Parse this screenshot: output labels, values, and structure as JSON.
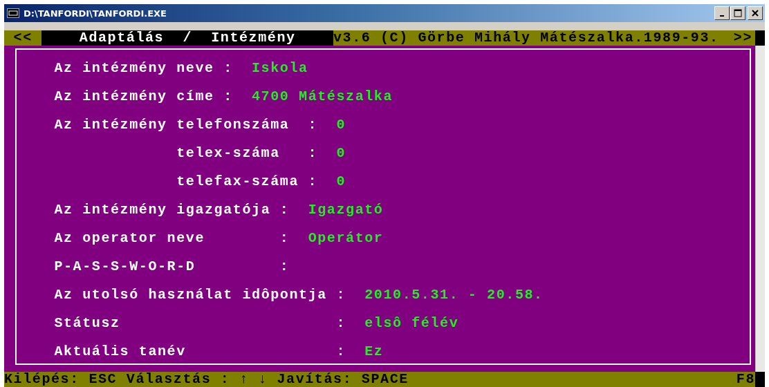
{
  "window": {
    "title": "D:\\TANFORDI\\TANFORDI.EXE"
  },
  "header": {
    "left_arrow": "<<",
    "title": "Adaptálás  /  Intézmény",
    "copyright": "v3.6 (C) Görbe Mihály Mátészalka.1989-93.",
    "right_arrow": ">>"
  },
  "groups": [
    {
      "rows": [
        {
          "label": "Az intézmény neve",
          "separator": ":",
          "value": "Iskola"
        },
        {
          "label": "Az intézmény címe",
          "separator": ":",
          "value": "4700 Mátészalka"
        }
      ]
    },
    {
      "rows": [
        {
          "label": "Az intézmény telefonszáma",
          "separator": ":",
          "value": "0",
          "children": [
            {
              "label": "telex-száma",
              "separator": ":",
              "value": "0"
            },
            {
              "label": "telefax-száma",
              "separator": ":",
              "value": "0"
            }
          ]
        }
      ]
    },
    {
      "rows": [
        {
          "label": "Az intézmény igazgatója",
          "separator": ":",
          "value": "Igazgató"
        },
        {
          "label": "Az operator neve",
          "separator": ":",
          "value": "Operátor"
        },
        {
          "label": "P-A-S-S-W-O-R-D",
          "separator": ":"
        }
      ]
    },
    {
      "rows": [
        {
          "label": "Az utolsó használat idôpontja",
          "separator": ":",
          "value": "2010.5.31. - 20.58."
        },
        {
          "label": "Státusz",
          "separator": ":",
          "value": "elsô félév"
        },
        {
          "label": "Aktuális tanév",
          "separator": ":",
          "value": "Ez"
        }
      ]
    }
  ],
  "status_bar": {
    "keys": "Kilépés: ESC Választás : ↑ ↓ Javítás: SPACE",
    "function_key": "F8"
  }
}
